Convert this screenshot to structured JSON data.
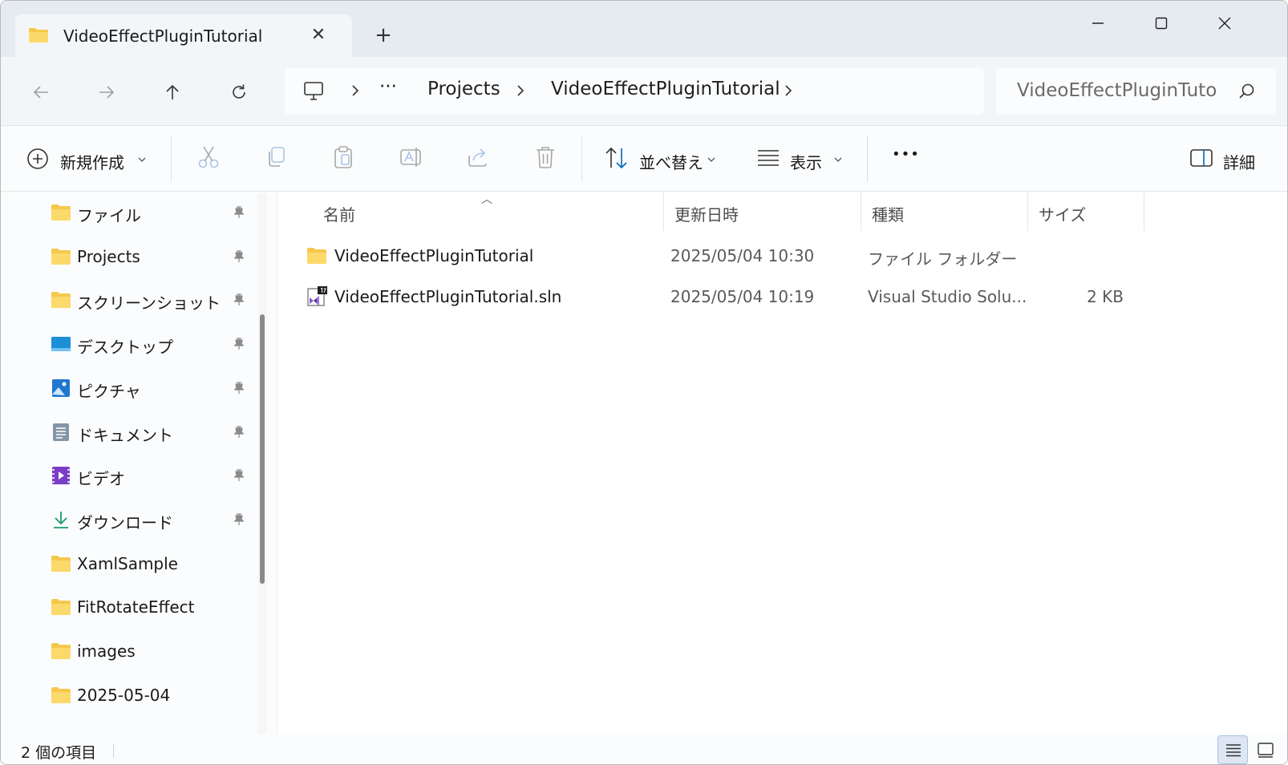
{
  "tab": {
    "title": "VideoEffectPluginTutorial",
    "close": "✕",
    "new_tab": "+"
  },
  "address": {
    "ellipsis": "···",
    "crumbs": [
      "Projects",
      "VideoEffectPluginTutorial"
    ]
  },
  "search": {
    "value": "VideoEffectPluginTuto"
  },
  "commands": {
    "new": "新規作成",
    "sort": "並べ替え",
    "view": "表示",
    "more": "•••",
    "details": "詳細"
  },
  "nav": {
    "items": [
      {
        "label": "ファイル",
        "icon": "folder-icon",
        "pinned": true
      },
      {
        "label": "Projects",
        "icon": "folder-icon",
        "pinned": true
      },
      {
        "label": "スクリーンショット",
        "icon": "folder-icon",
        "pinned": true
      },
      {
        "label": "デスクトップ",
        "icon": "desktop-icon",
        "pinned": true
      },
      {
        "label": "ピクチャ",
        "icon": "pictures-icon",
        "pinned": true
      },
      {
        "label": "ドキュメント",
        "icon": "documents-icon",
        "pinned": true
      },
      {
        "label": "ビデオ",
        "icon": "videos-icon",
        "pinned": true
      },
      {
        "label": "ダウンロード",
        "icon": "download-icon",
        "pinned": true
      },
      {
        "label": "XamlSample",
        "icon": "folder-icon",
        "pinned": false
      },
      {
        "label": "FitRotateEffect",
        "icon": "folder-icon",
        "pinned": false
      },
      {
        "label": "images",
        "icon": "folder-icon",
        "pinned": false
      },
      {
        "label": "2025-05-04",
        "icon": "folder-icon",
        "pinned": false
      }
    ]
  },
  "columns": {
    "name": "名前",
    "modified": "更新日時",
    "type": "種類",
    "size": "サイズ"
  },
  "files": [
    {
      "name": "VideoEffectPluginTutorial",
      "modified": "2025/05/04 10:30",
      "type": "ファイル フォルダー",
      "size": "",
      "icon": "folder-icon"
    },
    {
      "name": "VideoEffectPluginTutorial.sln",
      "modified": "2025/05/04 10:19",
      "type": "Visual Studio Solu...",
      "size": "2 KB",
      "icon": "visual-studio-solution-icon"
    }
  ],
  "status": {
    "item_count": "2 個の項目"
  },
  "colors": {
    "folder": "#f5c84c",
    "accent": "#0067c0",
    "chrome": "#e6ebf1"
  }
}
